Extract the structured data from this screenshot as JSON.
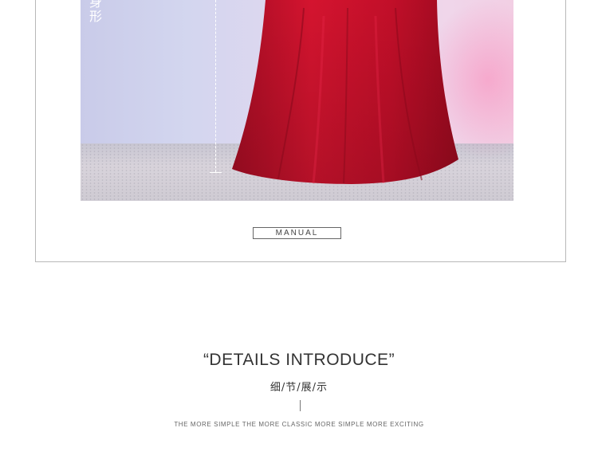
{
  "product_photo": {
    "height_label": "身形",
    "dress_color": "#c8102e"
  },
  "manual": {
    "label": "MANUAL"
  },
  "details": {
    "title": "“DETAILS INTRODUCE”",
    "subtitle": "细/节/展/示",
    "tagline": "THE MORE SIMPLE THE MORE CLASSIC MORE SIMPLE MORE EXCITING"
  }
}
